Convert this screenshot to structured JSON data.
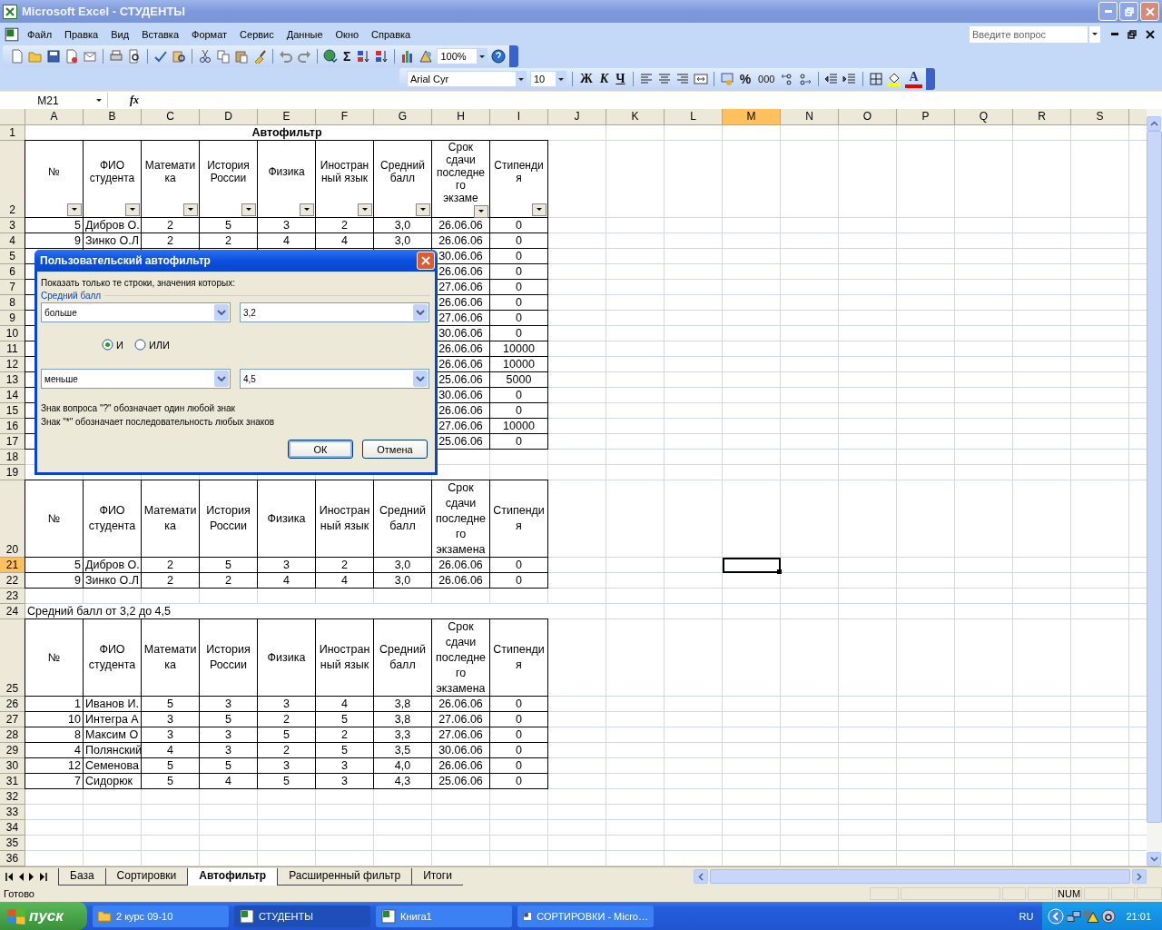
{
  "window": {
    "title": "Microsoft Excel - СТУДЕНТЫ"
  },
  "menu": [
    {
      "label": "Файл"
    },
    {
      "label": "Правка"
    },
    {
      "label": "Вид"
    },
    {
      "label": "Вставка"
    },
    {
      "label": "Формат"
    },
    {
      "label": "Сервис"
    },
    {
      "label": "Данные"
    },
    {
      "label": "Окно"
    },
    {
      "label": "Справка"
    }
  ],
  "help_box": {
    "placeholder": "Введите вопрос"
  },
  "standard_toolbar": {
    "sum_symbol": "Σ",
    "zoom": "100%"
  },
  "format_toolbar": {
    "font": "Arial Cyr",
    "size": "10",
    "bold": "Ж",
    "italic": "К",
    "underline": "Ч",
    "percent": "%",
    "thousands": "000",
    "font_color_letter": "A"
  },
  "formula_bar": {
    "name_box": "M21",
    "fx": "fx"
  },
  "sheet": {
    "columns": [
      {
        "label": "A",
        "selected": false
      },
      {
        "label": "B",
        "selected": false
      },
      {
        "label": "C",
        "selected": false
      },
      {
        "label": "D",
        "selected": false
      },
      {
        "label": "E",
        "selected": false
      },
      {
        "label": "F",
        "selected": false
      },
      {
        "label": "G",
        "selected": false
      },
      {
        "label": "H",
        "selected": false
      },
      {
        "label": "I",
        "selected": false
      },
      {
        "label": "J",
        "selected": false
      },
      {
        "label": "K",
        "selected": false
      },
      {
        "label": "L",
        "selected": false
      },
      {
        "label": "M",
        "selected": true
      },
      {
        "label": "N",
        "selected": false
      },
      {
        "label": "O",
        "selected": false
      },
      {
        "label": "P",
        "selected": false
      },
      {
        "label": "Q",
        "selected": false
      },
      {
        "label": "R",
        "selected": false
      },
      {
        "label": "S",
        "selected": false
      }
    ],
    "rows": [
      {
        "header": "1",
        "selected": false,
        "kind": "title",
        "text": "Автофильтр"
      },
      {
        "header": "2",
        "selected": false,
        "kind": "table_header",
        "filter_buttons": true,
        "cells": [
          "№",
          "ФИО\nстудента",
          "Математи\nка",
          "История\nРоссии",
          "Физика",
          "Иностран\nный язык",
          "Средний\nбалл",
          "Срок\nсдачи\nпоследне\nго\nэкзаме",
          "Стипенди\nя"
        ]
      },
      {
        "header": "3",
        "selected": false,
        "kind": "table_data",
        "cells": {
          "A": "5",
          "B": "Дибров О.",
          "C": "2",
          "D": "5",
          "E": "3",
          "F": "2",
          "G": "3,0",
          "H": "26.06.06",
          "I": "0"
        }
      },
      {
        "header": "4",
        "selected": false,
        "kind": "table_data",
        "cells": {
          "A": "9",
          "B": "Зинко О.Л",
          "C": "2",
          "D": "2",
          "E": "4",
          "F": "4",
          "G": "3,0",
          "H": "26.06.06",
          "I": "0"
        }
      },
      {
        "header": "5",
        "selected": false,
        "kind": "table_data",
        "cells": {
          "H": "30.06.06",
          "I": "0"
        }
      },
      {
        "header": "6",
        "selected": false,
        "kind": "table_data",
        "cells": {
          "H": "26.06.06",
          "I": "0"
        }
      },
      {
        "header": "7",
        "selected": false,
        "kind": "table_data",
        "cells": {
          "H": "27.06.06",
          "I": "0"
        }
      },
      {
        "header": "8",
        "selected": false,
        "kind": "table_data",
        "cells": {
          "H": "26.06.06",
          "I": "0"
        }
      },
      {
        "header": "9",
        "selected": false,
        "kind": "table_data",
        "cells": {
          "H": "27.06.06",
          "I": "0"
        }
      },
      {
        "header": "10",
        "selected": false,
        "kind": "table_data",
        "cells": {
          "H": "30.06.06",
          "I": "0"
        }
      },
      {
        "header": "11",
        "selected": false,
        "kind": "table_data",
        "cells": {
          "H": "26.06.06",
          "I": "10000"
        }
      },
      {
        "header": "12",
        "selected": false,
        "kind": "table_data",
        "cells": {
          "H": "26.06.06",
          "I": "10000"
        }
      },
      {
        "header": "13",
        "selected": false,
        "kind": "table_data",
        "cells": {
          "H": "25.06.06",
          "I": "5000"
        }
      },
      {
        "header": "14",
        "selected": false,
        "kind": "table_data",
        "cells": {
          "H": "30.06.06",
          "I": "0"
        }
      },
      {
        "header": "15",
        "selected": false,
        "kind": "table_data",
        "cells": {
          "H": "26.06.06",
          "I": "0"
        }
      },
      {
        "header": "16",
        "selected": false,
        "kind": "table_data",
        "cells": {
          "H": "27.06.06",
          "I": "10000"
        }
      },
      {
        "header": "17",
        "selected": false,
        "kind": "table_data",
        "cells": {
          "H": "25.06.06",
          "I": "0"
        }
      },
      {
        "header": "18",
        "selected": false,
        "kind": "empty"
      },
      {
        "header": "19",
        "selected": false,
        "kind": "empty"
      },
      {
        "header": "20",
        "selected": false,
        "kind": "table_header",
        "filter_buttons": false,
        "cells": [
          "№",
          "ФИО\nстудента",
          "Математи\nка",
          "История\nРоссии",
          "Физика",
          "Иностран\nный язык",
          "Средний\nбалл",
          "Срок\nсдачи\nпоследне\nго\nэкзамена",
          "Стипенди\nя"
        ]
      },
      {
        "header": "21",
        "selected": true,
        "kind": "table_data",
        "cells": {
          "A": "5",
          "B": "Дибров О.",
          "C": "2",
          "D": "5",
          "E": "3",
          "F": "2",
          "G": "3,0",
          "H": "26.06.06",
          "I": "0"
        }
      },
      {
        "header": "22",
        "selected": false,
        "kind": "table_data",
        "cells": {
          "A": "9",
          "B": "Зинко О.Л",
          "C": "2",
          "D": "2",
          "E": "4",
          "F": "4",
          "G": "3,0",
          "H": "26.06.06",
          "I": "0"
        }
      },
      {
        "header": "23",
        "selected": false,
        "kind": "empty"
      },
      {
        "header": "24",
        "selected": false,
        "kind": "text",
        "text": "Средний балл от 3,2 до 4,5"
      },
      {
        "header": "25",
        "selected": false,
        "kind": "table_header",
        "filter_buttons": false,
        "cells": [
          "№",
          "ФИО\nстудента",
          "Математи\nка",
          "История\nРоссии",
          "Физика",
          "Иностран\nный язык",
          "Средний\nбалл",
          "Срок\nсдачи\nпоследне\nго\nэкзамена",
          "Стипенди\nя"
        ]
      },
      {
        "header": "26",
        "selected": false,
        "kind": "table_data",
        "cells": {
          "A": "1",
          "B": "Иванов И.",
          "C": "5",
          "D": "3",
          "E": "3",
          "F": "4",
          "G": "3,8",
          "H": "26.06.06",
          "I": "0"
        }
      },
      {
        "header": "27",
        "selected": false,
        "kind": "table_data",
        "cells": {
          "A": "10",
          "B": "Интегра А",
          "C": "3",
          "D": "5",
          "E": "2",
          "F": "5",
          "G": "3,8",
          "H": "27.06.06",
          "I": "0"
        }
      },
      {
        "header": "28",
        "selected": false,
        "kind": "table_data",
        "cells": {
          "A": "8",
          "B": "Максим О",
          "C": "3",
          "D": "3",
          "E": "5",
          "F": "2",
          "G": "3,3",
          "H": "27.06.06",
          "I": "0"
        }
      },
      {
        "header": "29",
        "selected": false,
        "kind": "table_data",
        "cells": {
          "A": "4",
          "B": "Полянский",
          "C": "4",
          "D": "3",
          "E": "2",
          "F": "5",
          "G": "3,5",
          "H": "30.06.06",
          "I": "0"
        }
      },
      {
        "header": "30",
        "selected": false,
        "kind": "table_data",
        "cells": {
          "A": "12",
          "B": "Семенова",
          "C": "5",
          "D": "5",
          "E": "3",
          "F": "3",
          "G": "4,0",
          "H": "26.06.06",
          "I": "0"
        }
      },
      {
        "header": "31",
        "selected": false,
        "kind": "table_data",
        "cells": {
          "A": "7",
          "B": "Сидорюк",
          "C": "5",
          "D": "4",
          "E": "5",
          "F": "3",
          "G": "4,3",
          "H": "25.06.06",
          "I": "0"
        }
      },
      {
        "header": "32",
        "selected": false,
        "kind": "empty"
      },
      {
        "header": "33",
        "selected": false,
        "kind": "empty"
      },
      {
        "header": "34",
        "selected": false,
        "kind": "empty"
      },
      {
        "header": "35",
        "selected": false,
        "kind": "empty"
      },
      {
        "header": "36",
        "selected": false,
        "kind": "empty"
      }
    ]
  },
  "sheet_tabs": [
    {
      "label": "База",
      "selected": false
    },
    {
      "label": "Сортировки",
      "selected": false
    },
    {
      "label": "Автофильтр",
      "selected": true
    },
    {
      "label": "Расширенный фильтр",
      "selected": false
    },
    {
      "label": "Итоги",
      "selected": false
    }
  ],
  "status_bar": {
    "text": "Готово",
    "indicator": "NUM"
  },
  "dialog": {
    "title": "Пользовательский автофильтр",
    "prompt": "Показать только те строки, значения которых:",
    "field": "Средний балл",
    "condition_1": {
      "operator": "больше",
      "value": "3,2"
    },
    "logic": [
      {
        "label": "И",
        "selected": true
      },
      {
        "label": "ИЛИ",
        "selected": false
      }
    ],
    "condition_2": {
      "operator": "меньше",
      "value": "4,5"
    },
    "hints": [
      "Знак вопроса \"?\" обозначает один любой знак",
      "Знак \"*\" обозначает последовательность любых знаков"
    ],
    "buttons": [
      {
        "label": "ОК",
        "kind": "default"
      },
      {
        "label": "Отмена",
        "kind": "normal"
      }
    ]
  },
  "taskbar": {
    "start": "пуск",
    "tasks": [
      {
        "label": "2 курс 09-10",
        "kind": "folder",
        "selected": false
      },
      {
        "label": "СТУДЕНТЫ",
        "kind": "excel",
        "selected": true
      },
      {
        "label": "Книга1",
        "kind": "excel",
        "selected": false
      },
      {
        "label": "СОРТИРОВКИ - Micro…",
        "kind": "word",
        "selected": false
      }
    ],
    "language": "RU",
    "clock": "21:01"
  }
}
